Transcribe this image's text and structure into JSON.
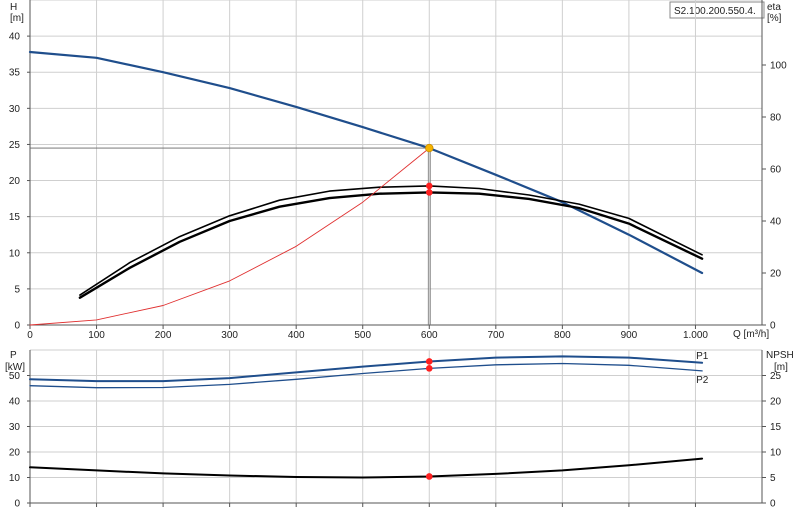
{
  "model_label": "S2.100.200.550.4.",
  "chart_data": [
    {
      "type": "line",
      "name": "pump-performance",
      "left_axis": {
        "unit_symbol": "H",
        "unit": "[m]",
        "ticks": [
          "0",
          "5",
          "10",
          "15",
          "20",
          "25",
          "30",
          "35",
          "40"
        ],
        "ylim": [
          0,
          45
        ]
      },
      "right_axis": {
        "unit_symbol": "eta",
        "unit": "[%]",
        "ticks": [
          "0",
          "20",
          "40",
          "60",
          "80",
          "100"
        ],
        "ylim": [
          0,
          125
        ]
      },
      "x_axis": {
        "ticks": [
          "0",
          "100",
          "200",
          "300",
          "400",
          "500",
          "600",
          "700",
          "800",
          "900",
          "1.000"
        ],
        "tick_values": [
          0,
          100,
          200,
          300,
          400,
          500,
          600,
          700,
          800,
          900,
          1000
        ],
        "xlim": [
          0,
          1100
        ],
        "label": "Q [m³/h]"
      },
      "grid": true,
      "series": [
        {
          "axis": "left",
          "color": "#1f4e8c",
          "width": 2.2,
          "x": [
            0,
            100,
            200,
            300,
            400,
            500,
            600,
            700,
            800,
            900,
            1010
          ],
          "y": [
            37.8,
            37.0,
            35.0,
            32.8,
            30.2,
            27.4,
            24.5,
            20.8,
            17.0,
            12.5,
            7.2
          ]
        },
        {
          "axis": "right",
          "color": "#000000",
          "width": 1.6,
          "x": [
            75,
            150,
            225,
            300,
            375,
            450,
            525,
            600,
            675,
            750,
            825,
            900,
            1010
          ],
          "y": [
            11.5,
            24,
            34,
            42,
            48,
            51.5,
            53,
            53.5,
            52.5,
            50,
            46.5,
            41,
            27
          ]
        },
        {
          "axis": "right",
          "color": "#000000",
          "width": 2.4,
          "x": [
            75,
            150,
            225,
            300,
            375,
            450,
            525,
            600,
            675,
            750,
            825,
            900,
            1010
          ],
          "y": [
            10.5,
            22,
            32,
            40,
            45.5,
            48.8,
            50.5,
            51,
            50.5,
            48.5,
            45,
            39,
            25.5
          ]
        },
        {
          "axis": "left",
          "color": "#e03030",
          "width": 0.9,
          "x": [
            0,
            100,
            200,
            300,
            400,
            500,
            600
          ],
          "y": [
            0,
            0.7,
            2.7,
            6.1,
            10.9,
            17.0,
            24.5
          ]
        }
      ],
      "duty_point": {
        "q": 600,
        "h": 24.5,
        "eta_upper": 53.5,
        "eta_lower": 51,
        "color_duty": "#f5b400",
        "color_marker": "#ff2020"
      }
    },
    {
      "type": "line",
      "name": "power-npsh",
      "left_axis": {
        "unit_symbol": "P",
        "unit": "[kW]",
        "ticks": [
          "0",
          "10",
          "20",
          "30",
          "40",
          "50"
        ],
        "ylim": [
          0,
          60
        ]
      },
      "right_axis": {
        "unit_symbol": "NPSH",
        "unit": "[m]",
        "ticks": [
          "0",
          "5",
          "10",
          "15",
          "20",
          "25"
        ],
        "ylim": [
          0,
          30
        ]
      },
      "x_axis": {
        "tick_values": [
          0,
          100,
          200,
          300,
          400,
          500,
          600,
          700,
          800,
          900,
          1000
        ],
        "xlim": [
          0,
          1100
        ]
      },
      "grid": true,
      "series": [
        {
          "label": "P1",
          "axis": "left",
          "color": "#1f4e8c",
          "width": 2.0,
          "x": [
            0,
            100,
            200,
            300,
            400,
            500,
            600,
            700,
            800,
            900,
            1010
          ],
          "y": [
            48.5,
            47.8,
            47.8,
            49,
            51.2,
            53.5,
            55.5,
            57,
            57.5,
            57,
            55
          ]
        },
        {
          "label": "P2",
          "axis": "left",
          "color": "#1f4e8c",
          "width": 1.3,
          "x": [
            0,
            100,
            200,
            300,
            400,
            500,
            600,
            700,
            800,
            900,
            1010
          ],
          "y": [
            46,
            45.2,
            45.3,
            46.5,
            48.5,
            50.8,
            52.8,
            54.2,
            54.7,
            54,
            51.8
          ]
        },
        {
          "axis": "right",
          "color": "#000000",
          "width": 2.0,
          "x": [
            0,
            100,
            200,
            300,
            400,
            500,
            600,
            700,
            800,
            900,
            1010
          ],
          "y": [
            7.0,
            6.4,
            5.8,
            5.4,
            5.1,
            5.0,
            5.2,
            5.7,
            6.4,
            7.4,
            8.7
          ]
        }
      ],
      "markers": [
        {
          "q": 600,
          "axis": "left",
          "v": 55.5
        },
        {
          "q": 600,
          "axis": "left",
          "v": 52.8
        },
        {
          "q": 600,
          "axis": "right",
          "v": 5.2
        }
      ]
    }
  ]
}
